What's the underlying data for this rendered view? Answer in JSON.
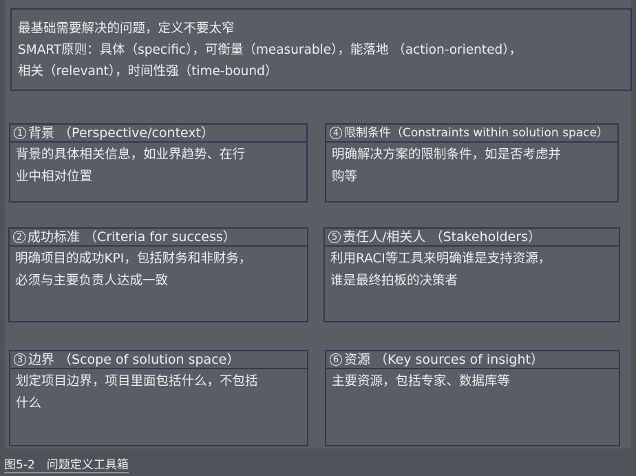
{
  "top_box": {
    "line1": "最基础需要解决的问题，定义不要太窄",
    "line2": "SMART原则：具体（specific），可衡量（measurable），能落地 （action-oriented），",
    "line3": "相关（relevant），时间性强（time-bound）"
  },
  "cards": [
    {
      "num": "1",
      "title": "背景 （Perspective/context）",
      "body_l1": "背景的具体相关信息，如业界趋势、在行",
      "body_l2": "业中相对位置"
    },
    {
      "num": "2",
      "title": "成功标准 （Criteria for success）",
      "body_l1": "明确项目的成功KPI，包括财务和非财务，",
      "body_l2": "必须与主要负责人达成一致"
    },
    {
      "num": "3",
      "title": "边界 （Scope of solution space）",
      "body_l1": "划定项目边界，项目里面包括什么，不包括",
      "body_l2": "什么"
    },
    {
      "num": "4",
      "title": "限制条件（Constraints within solution space）",
      "body_l1": "明确解决方案的限制条件，如是否考虑并",
      "body_l2": "购等"
    },
    {
      "num": "5",
      "title": "责任人/相关人 （Stakeholders）",
      "body_l1": "利用RACI等工具来明确谁是支持资源，",
      "body_l2": "谁是最终拍板的决策者"
    },
    {
      "num": "6",
      "title": "资源 （Key sources of insight）",
      "body_l1": "主要资源，包括专家、数据库等",
      "body_l2": ""
    }
  ],
  "caption": "图5-2　问题定义工具箱"
}
